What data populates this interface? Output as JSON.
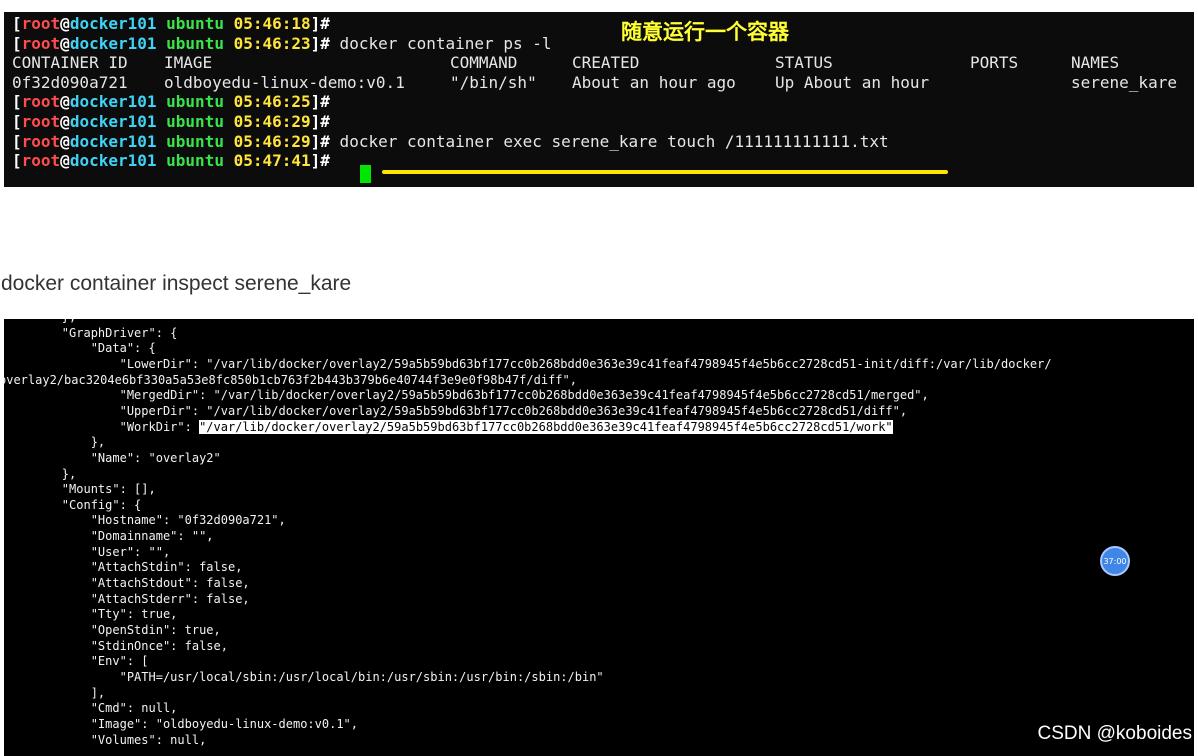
{
  "terminal1": {
    "annotation": "随意运行一个容器",
    "prompt": {
      "open": "[",
      "user": "root",
      "at": "@",
      "host": "docker101",
      "dir": "ubuntu",
      "close": "]#"
    },
    "lines": [
      {
        "time": "05:46:18",
        "cmd": ""
      },
      {
        "time": "05:46:23",
        "cmd": " docker container ps -l"
      }
    ],
    "ps_table": {
      "headers": [
        "CONTAINER ID",
        "IMAGE",
        "COMMAND",
        "CREATED",
        "STATUS",
        "PORTS",
        "NAMES"
      ],
      "row": [
        "0f32d090a721",
        "oldboyedu-linux-demo:v0.1",
        "\"/bin/sh\"",
        "About an hour ago",
        "Up About an hour",
        "",
        "serene_kare"
      ]
    },
    "lines2": [
      {
        "time": "05:46:25",
        "cmd": ""
      },
      {
        "time": "05:46:29",
        "cmd": ""
      },
      {
        "time": "05:46:29",
        "cmd": " docker container exec serene_kare touch /111111111111.txt"
      },
      {
        "time": "05:47:41",
        "cmd": " "
      }
    ]
  },
  "caption": "docker container inspect serene_kare",
  "terminal2": {
    "lines": [
      "        },",
      "        \"GraphDriver\": {",
      "            \"Data\": {",
      "                \"LowerDir\": \"/var/lib/docker/overlay2/59a5b59bd63bf177cc0b268bdd0e363e39c41feaf4798945f4e5b6cc2728cd51-init/diff:/var/lib/docker/",
      "overlay2/bac3204e6bf330a5a53e8fc850b1cb763f2b443b379b6e40744f3e9e0f98b47f/diff\",",
      "                \"MergedDir\": \"/var/lib/docker/overlay2/59a5b59bd63bf177cc0b268bdd0e363e39c41feaf4798945f4e5b6cc2728cd51/merged\",",
      "                \"UpperDir\": \"/var/lib/docker/overlay2/59a5b59bd63bf177cc0b268bdd0e363e39c41feaf4798945f4e5b6cc2728cd51/diff\",",
      "",
      "            },",
      "            \"Name\": \"overlay2\"",
      "        },",
      "        \"Mounts\": [],",
      "        \"Config\": {",
      "            \"Hostname\": \"0f32d090a721\",",
      "            \"Domainname\": \"\",",
      "            \"User\": \"\",",
      "            \"AttachStdin\": false,",
      "            \"AttachStdout\": false,",
      "            \"AttachStderr\": false,",
      "            \"Tty\": true,",
      "            \"OpenStdin\": true,",
      "            \"StdinOnce\": false,",
      "            \"Env\": [",
      "                \"PATH=/usr/local/sbin:/usr/local/bin:/usr/sbin:/usr/bin:/sbin:/bin\"",
      "            ],",
      "            \"Cmd\": null,",
      "            \"Image\": \"oldboyedu-linux-demo:v0.1\",",
      "            \"Volumes\": null,"
    ],
    "workdir_key": "                \"WorkDir\": ",
    "workdir_value": "\"/var/lib/docker/overlay2/59a5b59bd63bf177cc0b268bdd0e363e39c41feaf4798945f4e5b6cc2728cd51/work\""
  },
  "badge": "37:00",
  "watermark": "CSDN @koboides",
  "colors": {
    "prompt_red": "#ff4d4d",
    "host_cyan": "#3fd2f5",
    "dir_green": "#39e34a",
    "time_yellow": "#ffe53b",
    "cursor_green": "#00e600",
    "annotation_yellow": "#ffff33"
  }
}
